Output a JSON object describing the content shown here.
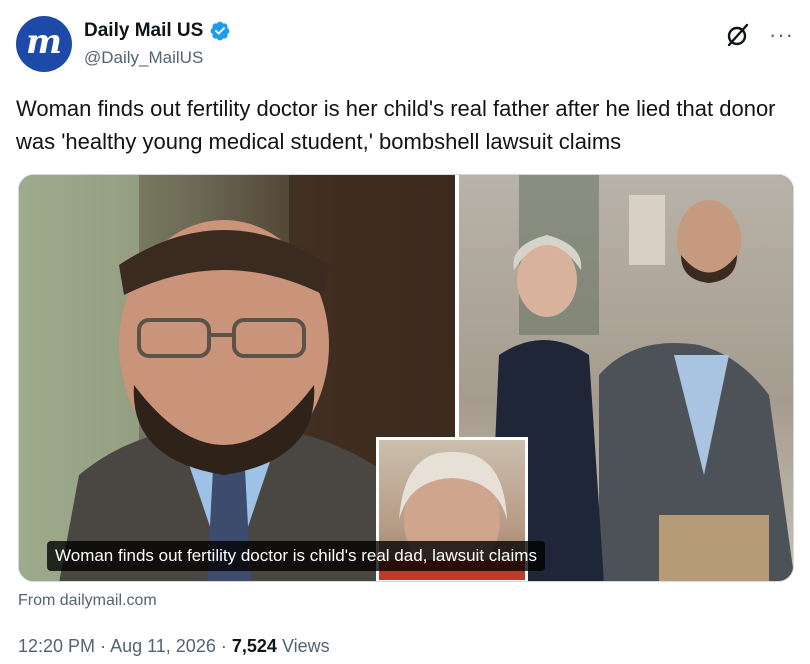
{
  "author": {
    "display_name": "Daily Mail US",
    "handle": "@Daily_MailUS",
    "avatar_letter": "m",
    "verified": true,
    "brand_color": "#1d4aa8",
    "verified_color": "#1d9bf0"
  },
  "actions": {
    "grok_icon": "grok-icon",
    "more_label": "···"
  },
  "tweet": {
    "text": "Woman finds out fertility doctor is her child's real father after he lied that donor was 'healthy young medical student,' bombshell lawsuit claims"
  },
  "media": {
    "caption": "Woman finds out fertility doctor is child's real dad, lawsuit claims"
  },
  "card": {
    "source": "From dailymail.com"
  },
  "meta": {
    "time": "12:20 PM",
    "separator": "·",
    "date": "Aug 11, 2026",
    "views_count": "7,524",
    "views_label": "Views"
  }
}
